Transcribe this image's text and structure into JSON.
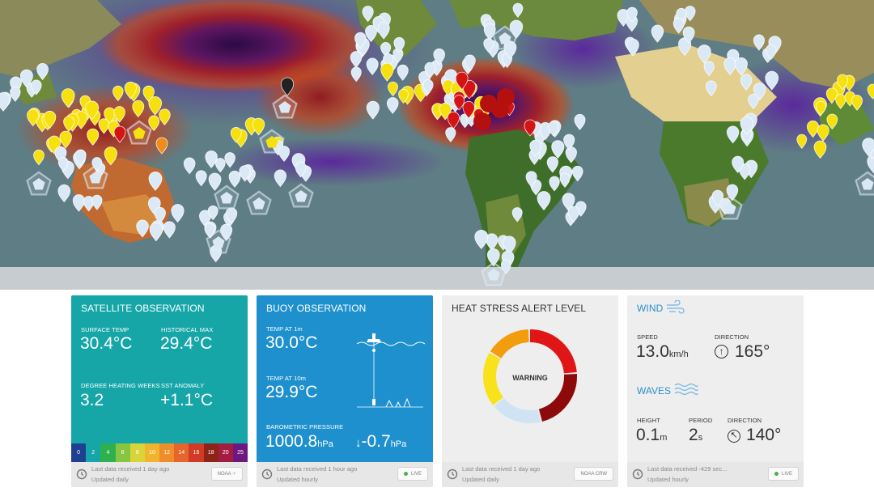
{
  "satellite": {
    "title": "SATELLITE OBSERVATION",
    "surface_temp_label": "SURFACE TEMP",
    "surface_temp": "30.4°C",
    "hist_max_label": "HISTORICAL MAX",
    "hist_max": "29.4°C",
    "dhw_label": "DEGREE HEATING WEEKS",
    "dhw": "3.2",
    "anomaly_label": "SST ANOMALY",
    "anomaly": "+1.1°C",
    "scale": [
      {
        "label": "0",
        "color": "#1f3f93"
      },
      {
        "label": "2",
        "color": "#17a6a8"
      },
      {
        "label": "4",
        "color": "#2fb04f"
      },
      {
        "label": "6",
        "color": "#88c540"
      },
      {
        "label": "8",
        "color": "#d9d43a"
      },
      {
        "label": "10",
        "color": "#f1b52d"
      },
      {
        "label": "12",
        "color": "#ef8d2a"
      },
      {
        "label": "14",
        "color": "#e5652a"
      },
      {
        "label": "16",
        "color": "#d23a26"
      },
      {
        "label": "18",
        "color": "#8e2418"
      },
      {
        "label": "20",
        "color": "#a21d3f"
      },
      {
        "label": "25",
        "color": "#6f1780"
      }
    ],
    "footer_line1": "Last data received 1 day ago",
    "footer_line2": "Updated daily",
    "chip": "NOAA"
  },
  "buoy": {
    "title": "BUOY OBSERVATION",
    "temp1_label": "TEMP AT 1m",
    "temp1": "30.0°C",
    "temp10_label": "TEMP AT 10m",
    "temp10": "29.9°C",
    "pressure_label": "BAROMETRIC PRESSURE",
    "pressure": "1000.8",
    "pressure_unit": "hPa",
    "pressure_change": "-0.7",
    "pressure_change_unit": "hPa",
    "footer_line1": "Last data received 1 hour ago",
    "footer_line2": "Updated hourly",
    "chip": "LIVE"
  },
  "heat_stress": {
    "title": "HEAT STRESS ALERT LEVEL",
    "level": "WARNING",
    "colors": {
      "red": "#e01616",
      "darkred": "#8e0a0a",
      "blue": "#cfe3f4",
      "yellow": "#f7e21b",
      "orange": "#f39c0d"
    },
    "footer_line1": "Last data received 1 day ago",
    "footer_line2": "Updated daily",
    "chip": "NOAA CRW"
  },
  "wind": {
    "title": "WIND",
    "speed_label": "SPEED",
    "speed": "13.0",
    "speed_unit": "km/h",
    "direction_label": "DIRECTION",
    "direction": "165°",
    "waves_title": "WAVES",
    "height_label": "HEIGHT",
    "height": "0.1",
    "height_unit": "m",
    "period_label": "PERIOD",
    "period": "2",
    "period_unit": "s",
    "wave_direction_label": "DIRECTION",
    "wave_direction": "140°",
    "footer_line1": "Last data received -429 sec...",
    "footer_line2": "Updated hourly",
    "chip": "LIVE"
  }
}
